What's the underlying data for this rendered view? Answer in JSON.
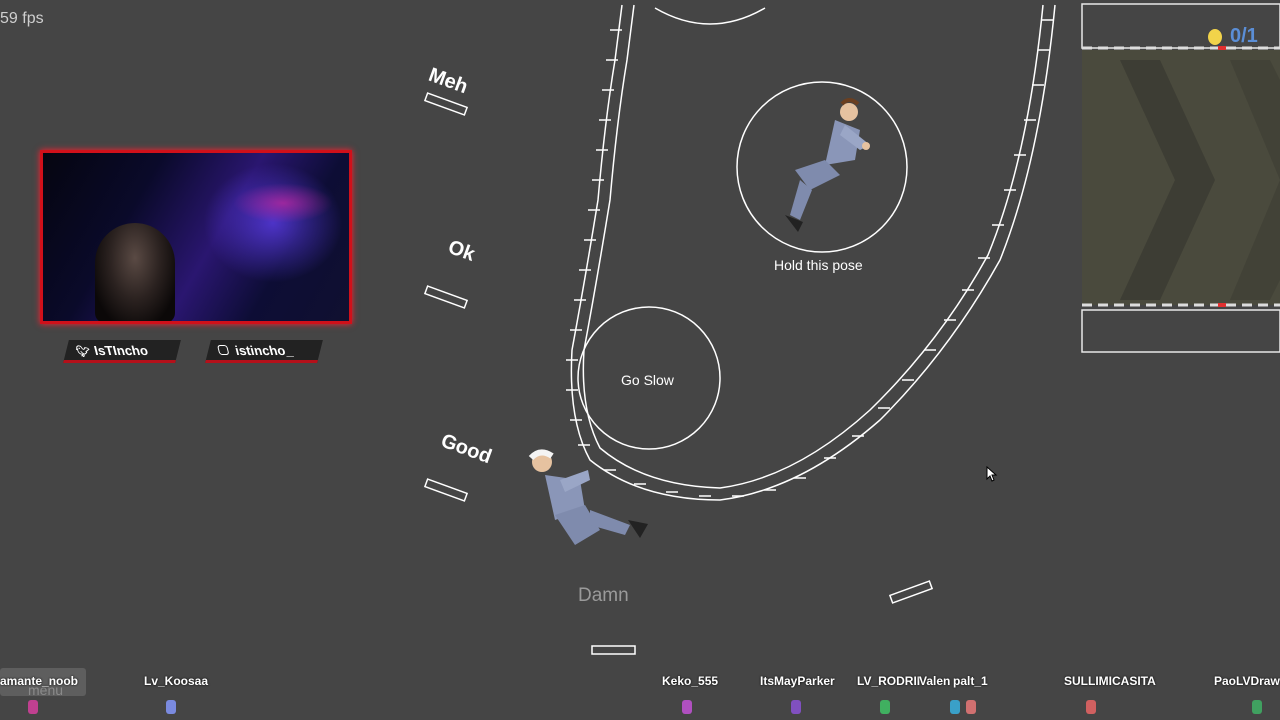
{
  "hud": {
    "fps_label": "59 fps",
    "coin_count": "0/1",
    "cursor_icon": "arrow-cursor-icon"
  },
  "stream_overlay": {
    "twitter_handle": "IsTIncho",
    "instagram_handle": "istincho_",
    "twitter_icon": "twitter-bird-icon",
    "instagram_icon": "instagram-icon",
    "frame_color": "#d0101a"
  },
  "landing_ratings": [
    "Meh",
    "Ok",
    "Good",
    "Damn"
  ],
  "pose_prompts": {
    "hold_pose": "Hold this pose",
    "go_slow": "Go Slow"
  },
  "menu": {
    "label": "menu"
  },
  "viewers": [
    {
      "name": "amante_noob",
      "color": "#c04090"
    },
    {
      "name": "Lv_Koosaa",
      "color": "#7a8adf"
    },
    {
      "name": "Keko_555",
      "color": "#b050c0"
    },
    {
      "name": "ItsMayParker",
      "color": "#8050c0"
    },
    {
      "name": "LV_RODRII",
      "color": "#40b060"
    },
    {
      "name": "Valen",
      "color": "#3aa0c8"
    },
    {
      "name": "palt_1",
      "color": "#d07070"
    },
    {
      "name": "SULLIMICASITA",
      "color": "#d06060"
    },
    {
      "name": "PaoLVDraw",
      "color": "#40a060"
    }
  ],
  "colors": {
    "background": "#454545",
    "track_stroke": "#ffffff",
    "coin": "#f2d34a",
    "score": "#5b8ed6",
    "goal_zone": "#4a4a3a"
  }
}
